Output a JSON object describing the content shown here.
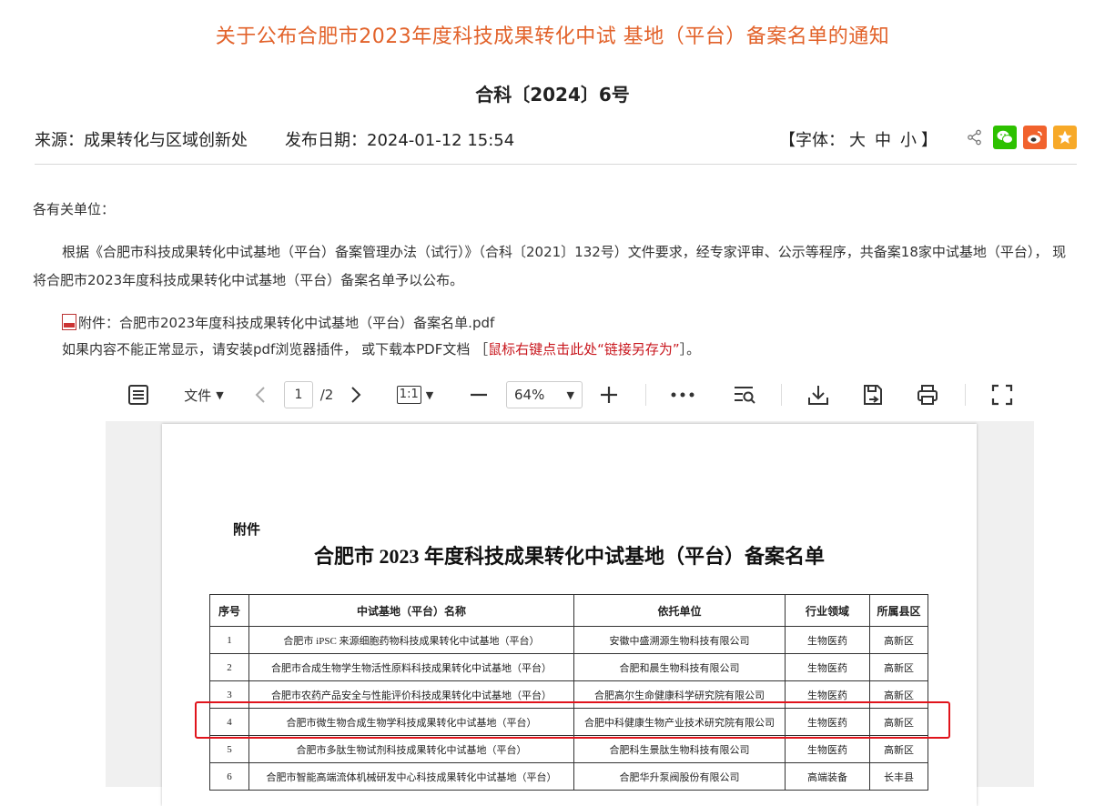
{
  "article": {
    "title": "关于公布合肥市2023年度科技成果转化中试 基地（平台）备案名单的通知",
    "doc_number": "合科〔2024〕6号",
    "source": "来源：成果转化与区域创新处",
    "date": "发布日期：2024-01-12 15:54",
    "font_prefix": "【字体：",
    "font_large": "大",
    "font_medium": "中",
    "font_small": "小",
    "font_suffix": "】"
  },
  "share": {
    "icons": [
      "share-icon",
      "wechat-icon",
      "weibo-icon",
      "favorite-icon"
    ],
    "wechat_color": "#2dc100",
    "weibo_color": "#f1622d",
    "favorite_color": "#f7a928"
  },
  "content": {
    "greeting": "各有关单位：",
    "paragraph": "根据《合肥市科技成果转化中试基地（平台）备案管理办法（试行）》（合科〔2021〕132号）文件要求，经专家评审、公示等程序，共备案18家中试基地（平台）， 现将合肥市2023年度科技成果转化中试基地（平台）备案名单予以公布。",
    "attachment": "附件：合肥市2023年度科技成果转化中试基地（平台）备案名单.pdf",
    "hint_prefix": "如果内容不能正常显示，请安装pdf浏览器插件， 或下载本PDF文档 ［",
    "hint_link": "鼠标右键点击此处“链接另存为”",
    "hint_suffix": "］。"
  },
  "viewer_toolbar": {
    "file_menu": "文件",
    "current_page": "1",
    "total_pages": "/2",
    "fit_label": "1:1",
    "zoom": "64%"
  },
  "pdf_page": {
    "label": "附件",
    "title": "合肥市 2023 年度科技成果转化中试基地（平台）备案名单",
    "columns": [
      "序号",
      "中试基地（平台）名称",
      "依托单位",
      "行业领域",
      "所属县区"
    ],
    "rows": [
      [
        "1",
        "合肥市 iPSC 来源细胞药物科技成果转化中试基地（平台）",
        "安徽中盛溯源生物科技有限公司",
        "生物医药",
        "高新区"
      ],
      [
        "2",
        "合肥市合成生物学生物活性原料科技成果转化中试基地（平台）",
        "合肥和晨生物科技有限公司",
        "生物医药",
        "高新区"
      ],
      [
        "3",
        "合肥市农药产品安全与性能评价科技成果转化中试基地（平台）",
        "合肥高尔生命健康科学研究院有限公司",
        "生物医药",
        "高新区"
      ],
      [
        "4",
        "合肥市微生物合成生物学科技成果转化中试基地（平台）",
        "合肥中科健康生物产业技术研究院有限公司",
        "生物医药",
        "高新区"
      ],
      [
        "5",
        "合肥市多肽生物试剂科技成果转化中试基地（平台）",
        "合肥科生景肽生物科技有限公司",
        "生物医药",
        "高新区"
      ],
      [
        "6",
        "合肥市智能高端流体机械研发中心科技成果转化中试基地（平台）",
        "合肥华升泵阀股份有限公司",
        "高端装备",
        "长丰县"
      ]
    ]
  }
}
